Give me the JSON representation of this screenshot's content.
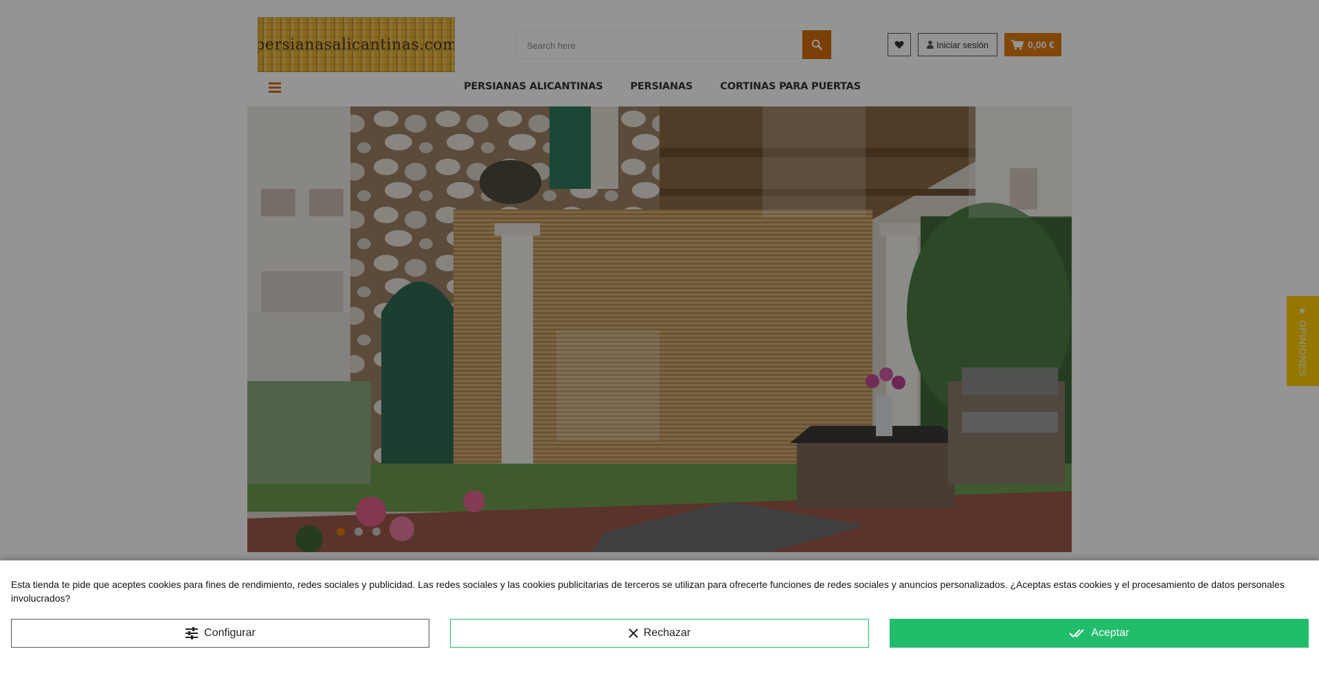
{
  "header": {
    "logo_text": "persianasalicantinas.com",
    "search": {
      "placeholder": "Search here"
    },
    "login_label": "Iniciar sesión",
    "cart_total": "0,00 €"
  },
  "nav": {
    "items": [
      "PERSIANAS ALICANTINAS",
      "PERSIANAS",
      "CORTINAS PARA PUERTAS"
    ]
  },
  "slider": {
    "slide_count": 3,
    "active_index": 0
  },
  "opinions_tab": {
    "label": "★ OPINIONES"
  },
  "cookie_banner": {
    "text": "Esta tienda te pide que aceptes cookies para fines de rendimiento, redes sociales y publicidad. Las redes sociales y las cookies publicitarias de terceros se utilizan para ofrecerte funciones de redes sociales y anuncios personalizados. ¿Aceptas estas cookies y el procesamiento de datos personales involucrados?",
    "configure_label": "Configurar",
    "reject_label": "Rechazar",
    "accept_label": "Aceptar"
  },
  "colors": {
    "accent": "#e07b12",
    "search_button": "#d46b08",
    "accept_green": "#21bd6a",
    "opinions_yellow": "#ffcc00"
  },
  "icons": {
    "search_button": "search-icon",
    "wishlist": "heart-icon",
    "login": "user-icon",
    "cart": "cart-icon",
    "menu": "hamburger-menu-icon",
    "configure": "sliders-icon",
    "reject": "close-icon",
    "accept": "double-check-icon"
  }
}
